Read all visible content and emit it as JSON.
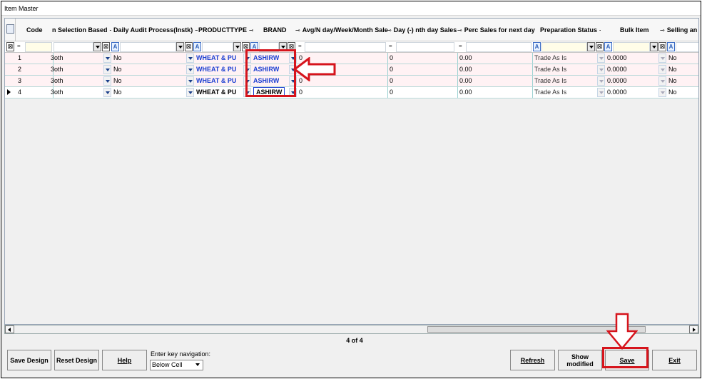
{
  "window": {
    "title": "Item Master"
  },
  "columns": [
    {
      "label": "Code"
    },
    {
      "label": "n Selection Based"
    },
    {
      "label": "Daily Audit Process(Instk)"
    },
    {
      "label": "PRODUCTTYPE"
    },
    {
      "label": "BRAND"
    },
    {
      "label": "Avg/N day/Week/Month Sale"
    },
    {
      "label": "Day (-) nth day Sales"
    },
    {
      "label": "Perc Sales for next day"
    },
    {
      "label": "Preparation Status"
    },
    {
      "label": "Bulk Item"
    },
    {
      "label": "Selling an"
    }
  ],
  "filter_row": {
    "eq_op": "=",
    "x_symbol": "⊠",
    "a_symbol": "A"
  },
  "rows": [
    {
      "code": "1",
      "selection": "3oth",
      "audit": "No",
      "producttype": "WHEAT & PU",
      "brand": "ASHIRW",
      "avg": "0",
      "day": "0",
      "perc": "0.00",
      "prep": "Trade As Is",
      "bulk": "0.0000",
      "selling": "No"
    },
    {
      "code": "2",
      "selection": "3oth",
      "audit": "No",
      "producttype": "WHEAT & PU",
      "brand": "ASHIRW",
      "avg": "0",
      "day": "0",
      "perc": "0.00",
      "prep": "Trade As Is",
      "bulk": "0.0000",
      "selling": "No"
    },
    {
      "code": "3",
      "selection": "3oth",
      "audit": "No",
      "producttype": "WHEAT & PU",
      "brand": "ASHIRW",
      "avg": "0",
      "day": "0",
      "perc": "0.00",
      "prep": "Trade As Is",
      "bulk": "0.0000",
      "selling": "No"
    },
    {
      "code": "4",
      "selection": "3oth",
      "audit": "No",
      "producttype": "WHEAT & PU",
      "brand": "ASHIRW",
      "avg": "0",
      "day": "0",
      "perc": "0.00",
      "prep": "Trade As Is",
      "bulk": "0.0000",
      "selling": "No"
    }
  ],
  "pager": {
    "text": "4 of 4"
  },
  "buttons": {
    "save_design": "Save Design",
    "reset_design": "Reset Design",
    "help": "Help",
    "refresh": "Refresh",
    "show_modified": "Show modified",
    "save": "Save",
    "exit": "Exit"
  },
  "navigation": {
    "label": "Enter key navigation:",
    "value": "Below Cell"
  },
  "colors": {
    "highlight": "#d6141c",
    "product_text": "#1c3fd1",
    "row_pink": "#fff2f4",
    "filter_yellow": "#fffde8"
  },
  "icons": [
    "pin-icon",
    "dropdown-arrow-icon",
    "clear-filter-icon",
    "text-filter-icon",
    "row-indicator-icon",
    "scroll-left-icon",
    "scroll-right-icon",
    "red-left-arrow",
    "red-down-arrow"
  ]
}
